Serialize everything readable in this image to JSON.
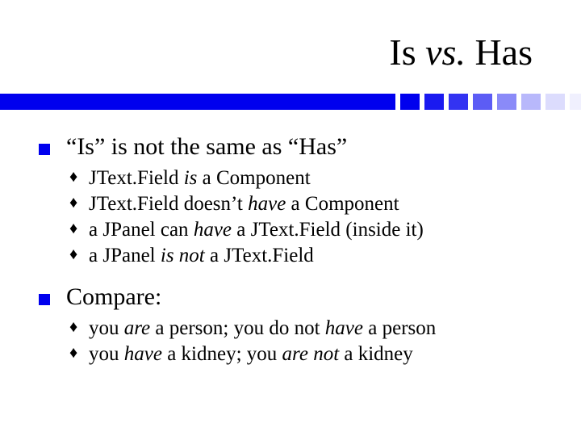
{
  "title": {
    "a": "Is ",
    "vs": "vs.",
    "b": " Has"
  },
  "bar": {
    "main_width": 490,
    "gap": 6,
    "seg_width": 24,
    "colors": [
      "#0000ee",
      "#1a1af0",
      "#3333f2",
      "#5c5cf5",
      "#8a8af8",
      "#b8b8fb",
      "#dcdcfd",
      "#f0f0fe"
    ]
  },
  "body": [
    {
      "heading": "“Is” is not the same as “Has”",
      "items": [
        [
          {
            "t": "JText.Field "
          },
          {
            "t": "is",
            "i": true
          },
          {
            "t": " a Component"
          }
        ],
        [
          {
            "t": "JText.Field doesn’t "
          },
          {
            "t": "have",
            "i": true
          },
          {
            "t": " a Component"
          }
        ],
        [
          {
            "t": "a JPanel can "
          },
          {
            "t": "have",
            "i": true
          },
          {
            "t": " a JText.Field (inside it)"
          }
        ],
        [
          {
            "t": "a JPanel "
          },
          {
            "t": "is not",
            "i": true
          },
          {
            "t": " a JText.Field"
          }
        ]
      ]
    },
    {
      "heading": "Compare:",
      "items": [
        [
          {
            "t": "you "
          },
          {
            "t": "are",
            "i": true
          },
          {
            "t": " a person; you do not "
          },
          {
            "t": "have",
            "i": true
          },
          {
            "t": " a person"
          }
        ],
        [
          {
            "t": "you "
          },
          {
            "t": "have",
            "i": true
          },
          {
            "t": " a kidney; you "
          },
          {
            "t": "are not",
            "i": true
          },
          {
            "t": " a kidney"
          }
        ]
      ]
    }
  ]
}
